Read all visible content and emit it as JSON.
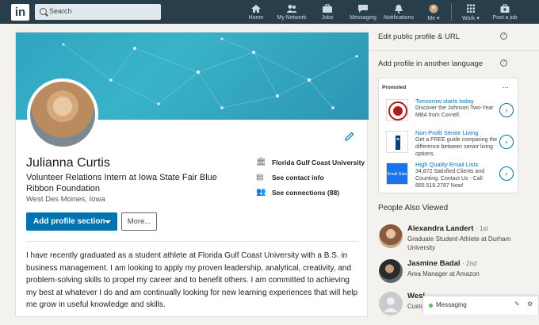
{
  "nav": {
    "logo": "in",
    "search_placeholder": "Search",
    "items": [
      {
        "label": "Home",
        "icon": "home-icon"
      },
      {
        "label": "My Network",
        "icon": "network-icon"
      },
      {
        "label": "Jobs",
        "icon": "briefcase-icon"
      },
      {
        "label": "Messaging",
        "icon": "chat-icon"
      },
      {
        "label": "Notifications",
        "icon": "bell-icon"
      },
      {
        "label": "Me",
        "icon": "avatar-icon"
      },
      {
        "label": "Work",
        "icon": "grid-icon"
      },
      {
        "label": "Post a job",
        "icon": "briefcase-plus-icon"
      }
    ]
  },
  "profile": {
    "name": "Julianna Curtis",
    "headline": "Volunteer Relations Intern at Iowa State Fair Blue Ribbon Foundation",
    "location": "West Des Moines, Iowa",
    "school": "Florida Gulf Coast University",
    "contact": "See contact info",
    "connections": "See connections (88)",
    "add_section": "Add profile section",
    "more": "More...",
    "summary": "I have recently graduated as a student athlete at Florida Gulf Coast University with a B.S. in business management. I am looking to apply my proven leadership, analytical, creativity, and problem-solving skills to propel my career and to benefit others. I am committed to achieving my best at whatever I do and am continually looking for new learning experiences that will help me grow in useful knowledge and skills."
  },
  "rail": {
    "edit_url": "Edit public profile & URL",
    "add_language": "Add profile in another language",
    "promoted": "Promoted",
    "promoted_more": "...",
    "ads": [
      {
        "title": "Tomorrow starts today",
        "body": "Discover the Johnson Two-Year MBA from Cornell.",
        "logo": "cornell-logo"
      },
      {
        "title": "Non-Profit Senior Living",
        "body": "Get a FREE guide comparing the difference between senior living options.",
        "logo": "senior-living-logo"
      },
      {
        "title": "High Quality Email Lists",
        "body": "34,872 Satisfied Clients and Counting. Contact Us - Call 855.518.2787 Now!",
        "logo": "email-lists-logo",
        "logo_text": "Email Data"
      }
    ],
    "people_title": "People Also Viewed",
    "people": [
      {
        "name": "Alexandra Landert",
        "degree": "· 1st",
        "headline": "Graduate Student-Athlete at Durham University"
      },
      {
        "name": "Jasmine Badal",
        "degree": "· 2nd",
        "headline": "Area Manager at Amazon"
      },
      {
        "name": "Wesl",
        "degree": "",
        "headline": "Custo"
      }
    ]
  },
  "messaging": {
    "label": "Messaging"
  },
  "colors": {
    "nav_bg": "#283e4a",
    "accent": "#0073b1",
    "banner": "#31a4c0"
  }
}
